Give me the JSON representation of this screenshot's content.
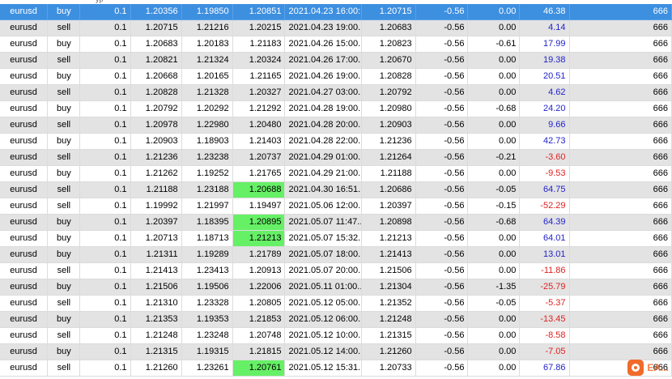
{
  "header_fragment": "yp",
  "rows": [
    {
      "symbol": "eurusd",
      "type": "buy",
      "volume": "0.1",
      "open_price": "1.20356",
      "sl": "1.19850",
      "tp": "1.20851",
      "tp_highlight": false,
      "time": "2021.04.23 16:00:...",
      "current_price": "1.20715",
      "commission": "-0.56",
      "swap": "0.00",
      "profit": "46.38",
      "profit_sign": "pos",
      "magic": "666",
      "selected": true
    },
    {
      "symbol": "eurusd",
      "type": "sell",
      "volume": "0.1",
      "open_price": "1.20715",
      "sl": "1.21216",
      "tp": "1.20215",
      "tp_highlight": false,
      "time": "2021.04.23 19:00...",
      "current_price": "1.20683",
      "commission": "-0.56",
      "swap": "0.00",
      "profit": "4.14",
      "profit_sign": "pos",
      "magic": "666"
    },
    {
      "symbol": "eurusd",
      "type": "buy",
      "volume": "0.1",
      "open_price": "1.20683",
      "sl": "1.20183",
      "tp": "1.21183",
      "tp_highlight": false,
      "time": "2021.04.26 15:00...",
      "current_price": "1.20823",
      "commission": "-0.56",
      "swap": "-0.61",
      "profit": "17.99",
      "profit_sign": "pos",
      "magic": "666"
    },
    {
      "symbol": "eurusd",
      "type": "sell",
      "volume": "0.1",
      "open_price": "1.20821",
      "sl": "1.21324",
      "tp": "1.20324",
      "tp_highlight": false,
      "time": "2021.04.26 17:00...",
      "current_price": "1.20670",
      "commission": "-0.56",
      "swap": "0.00",
      "profit": "19.38",
      "profit_sign": "pos",
      "magic": "666"
    },
    {
      "symbol": "eurusd",
      "type": "buy",
      "volume": "0.1",
      "open_price": "1.20668",
      "sl": "1.20165",
      "tp": "1.21165",
      "tp_highlight": false,
      "time": "2021.04.26 19:00...",
      "current_price": "1.20828",
      "commission": "-0.56",
      "swap": "0.00",
      "profit": "20.51",
      "profit_sign": "pos",
      "magic": "666"
    },
    {
      "symbol": "eurusd",
      "type": "sell",
      "volume": "0.1",
      "open_price": "1.20828",
      "sl": "1.21328",
      "tp": "1.20327",
      "tp_highlight": false,
      "time": "2021.04.27 03:00...",
      "current_price": "1.20792",
      "commission": "-0.56",
      "swap": "0.00",
      "profit": "4.62",
      "profit_sign": "pos",
      "magic": "666"
    },
    {
      "symbol": "eurusd",
      "type": "buy",
      "volume": "0.1",
      "open_price": "1.20792",
      "sl": "1.20292",
      "tp": "1.21292",
      "tp_highlight": false,
      "time": "2021.04.28 19:00...",
      "current_price": "1.20980",
      "commission": "-0.56",
      "swap": "-0.68",
      "profit": "24.20",
      "profit_sign": "pos",
      "magic": "666"
    },
    {
      "symbol": "eurusd",
      "type": "sell",
      "volume": "0.1",
      "open_price": "1.20978",
      "sl": "1.22980",
      "tp": "1.20480",
      "tp_highlight": false,
      "time": "2021.04.28 20:00...",
      "current_price": "1.20903",
      "commission": "-0.56",
      "swap": "0.00",
      "profit": "9.66",
      "profit_sign": "pos",
      "magic": "666"
    },
    {
      "symbol": "eurusd",
      "type": "buy",
      "volume": "0.1",
      "open_price": "1.20903",
      "sl": "1.18903",
      "tp": "1.21403",
      "tp_highlight": false,
      "time": "2021.04.28 22:00...",
      "current_price": "1.21236",
      "commission": "-0.56",
      "swap": "0.00",
      "profit": "42.73",
      "profit_sign": "pos",
      "magic": "666"
    },
    {
      "symbol": "eurusd",
      "type": "sell",
      "volume": "0.1",
      "open_price": "1.21236",
      "sl": "1.23238",
      "tp": "1.20737",
      "tp_highlight": false,
      "time": "2021.04.29 01:00...",
      "current_price": "1.21264",
      "commission": "-0.56",
      "swap": "-0.21",
      "profit": "-3.60",
      "profit_sign": "neg",
      "magic": "666"
    },
    {
      "symbol": "eurusd",
      "type": "buy",
      "volume": "0.1",
      "open_price": "1.21262",
      "sl": "1.19252",
      "tp": "1.21765",
      "tp_highlight": false,
      "time": "2021.04.29 21:00...",
      "current_price": "1.21188",
      "commission": "-0.56",
      "swap": "0.00",
      "profit": "-9.53",
      "profit_sign": "neg",
      "magic": "666"
    },
    {
      "symbol": "eurusd",
      "type": "sell",
      "volume": "0.1",
      "open_price": "1.21188",
      "sl": "1.23188",
      "tp": "1.20688",
      "tp_highlight": true,
      "time": "2021.04.30 16:51...",
      "current_price": "1.20686",
      "commission": "-0.56",
      "swap": "-0.05",
      "profit": "64.75",
      "profit_sign": "pos",
      "magic": "666"
    },
    {
      "symbol": "eurusd",
      "type": "sell",
      "volume": "0.1",
      "open_price": "1.19992",
      "sl": "1.21997",
      "tp": "1.19497",
      "tp_highlight": false,
      "time": "2021.05.06 12:00...",
      "current_price": "1.20397",
      "commission": "-0.56",
      "swap": "-0.15",
      "profit": "-52.29",
      "profit_sign": "neg",
      "magic": "666"
    },
    {
      "symbol": "eurusd",
      "type": "buy",
      "volume": "0.1",
      "open_price": "1.20397",
      "sl": "1.18395",
      "tp": "1.20895",
      "tp_highlight": true,
      "time": "2021.05.07 11:47...",
      "current_price": "1.20898",
      "commission": "-0.56",
      "swap": "-0.68",
      "profit": "64.39",
      "profit_sign": "pos",
      "magic": "666"
    },
    {
      "symbol": "eurusd",
      "type": "buy",
      "volume": "0.1",
      "open_price": "1.20713",
      "sl": "1.18713",
      "tp": "1.21213",
      "tp_highlight": true,
      "time": "2021.05.07 15:32...",
      "current_price": "1.21213",
      "commission": "-0.56",
      "swap": "0.00",
      "profit": "64.01",
      "profit_sign": "pos",
      "magic": "666"
    },
    {
      "symbol": "eurusd",
      "type": "buy",
      "volume": "0.1",
      "open_price": "1.21311",
      "sl": "1.19289",
      "tp": "1.21789",
      "tp_highlight": false,
      "time": "2021.05.07 18:00...",
      "current_price": "1.21413",
      "commission": "-0.56",
      "swap": "0.00",
      "profit": "13.01",
      "profit_sign": "pos",
      "magic": "666"
    },
    {
      "symbol": "eurusd",
      "type": "sell",
      "volume": "0.1",
      "open_price": "1.21413",
      "sl": "1.23413",
      "tp": "1.20913",
      "tp_highlight": false,
      "time": "2021.05.07 20:00...",
      "current_price": "1.21506",
      "commission": "-0.56",
      "swap": "0.00",
      "profit": "-11.86",
      "profit_sign": "neg",
      "magic": "666"
    },
    {
      "symbol": "eurusd",
      "type": "buy",
      "volume": "0.1",
      "open_price": "1.21506",
      "sl": "1.19506",
      "tp": "1.22006",
      "tp_highlight": false,
      "time": "2021.05.11 01:00...",
      "current_price": "1.21304",
      "commission": "-0.56",
      "swap": "-1.35",
      "profit": "-25.79",
      "profit_sign": "neg",
      "magic": "666"
    },
    {
      "symbol": "eurusd",
      "type": "sell",
      "volume": "0.1",
      "open_price": "1.21310",
      "sl": "1.23328",
      "tp": "1.20805",
      "tp_highlight": false,
      "time": "2021.05.12 05:00...",
      "current_price": "1.21352",
      "commission": "-0.56",
      "swap": "-0.05",
      "profit": "-5.37",
      "profit_sign": "neg",
      "magic": "666"
    },
    {
      "symbol": "eurusd",
      "type": "buy",
      "volume": "0.1",
      "open_price": "1.21353",
      "sl": "1.19353",
      "tp": "1.21853",
      "tp_highlight": false,
      "time": "2021.05.12 06:00...",
      "current_price": "1.21248",
      "commission": "-0.56",
      "swap": "0.00",
      "profit": "-13.45",
      "profit_sign": "neg",
      "magic": "666"
    },
    {
      "symbol": "eurusd",
      "type": "sell",
      "volume": "0.1",
      "open_price": "1.21248",
      "sl": "1.23248",
      "tp": "1.20748",
      "tp_highlight": false,
      "time": "2021.05.12 10:00...",
      "current_price": "1.21315",
      "commission": "-0.56",
      "swap": "0.00",
      "profit": "-8.58",
      "profit_sign": "neg",
      "magic": "666"
    },
    {
      "symbol": "eurusd",
      "type": "buy",
      "volume": "0.1",
      "open_price": "1.21315",
      "sl": "1.19315",
      "tp": "1.21815",
      "tp_highlight": false,
      "time": "2021.05.12 14:00...",
      "current_price": "1.21260",
      "commission": "-0.56",
      "swap": "0.00",
      "profit": "-7.05",
      "profit_sign": "neg",
      "magic": "666"
    },
    {
      "symbol": "eurusd",
      "type": "sell",
      "volume": "0.1",
      "open_price": "1.21260",
      "sl": "1.23261",
      "tp": "1.20761",
      "tp_highlight": true,
      "time": "2021.05.12 15:31...",
      "current_price": "1.20733",
      "commission": "-0.56",
      "swap": "0.00",
      "profit": "67.86",
      "profit_sign": "pos",
      "magic": "666"
    }
  ],
  "colors": {
    "selected_row": "#3d8fe0",
    "tp_hit_highlight": "#66f066",
    "profit_positive": "#2222cc",
    "profit_negative": "#e02020",
    "watermark": "#f06a2a"
  },
  "watermark": {
    "text": "EA...",
    "icon": "watermark-logo-icon"
  }
}
